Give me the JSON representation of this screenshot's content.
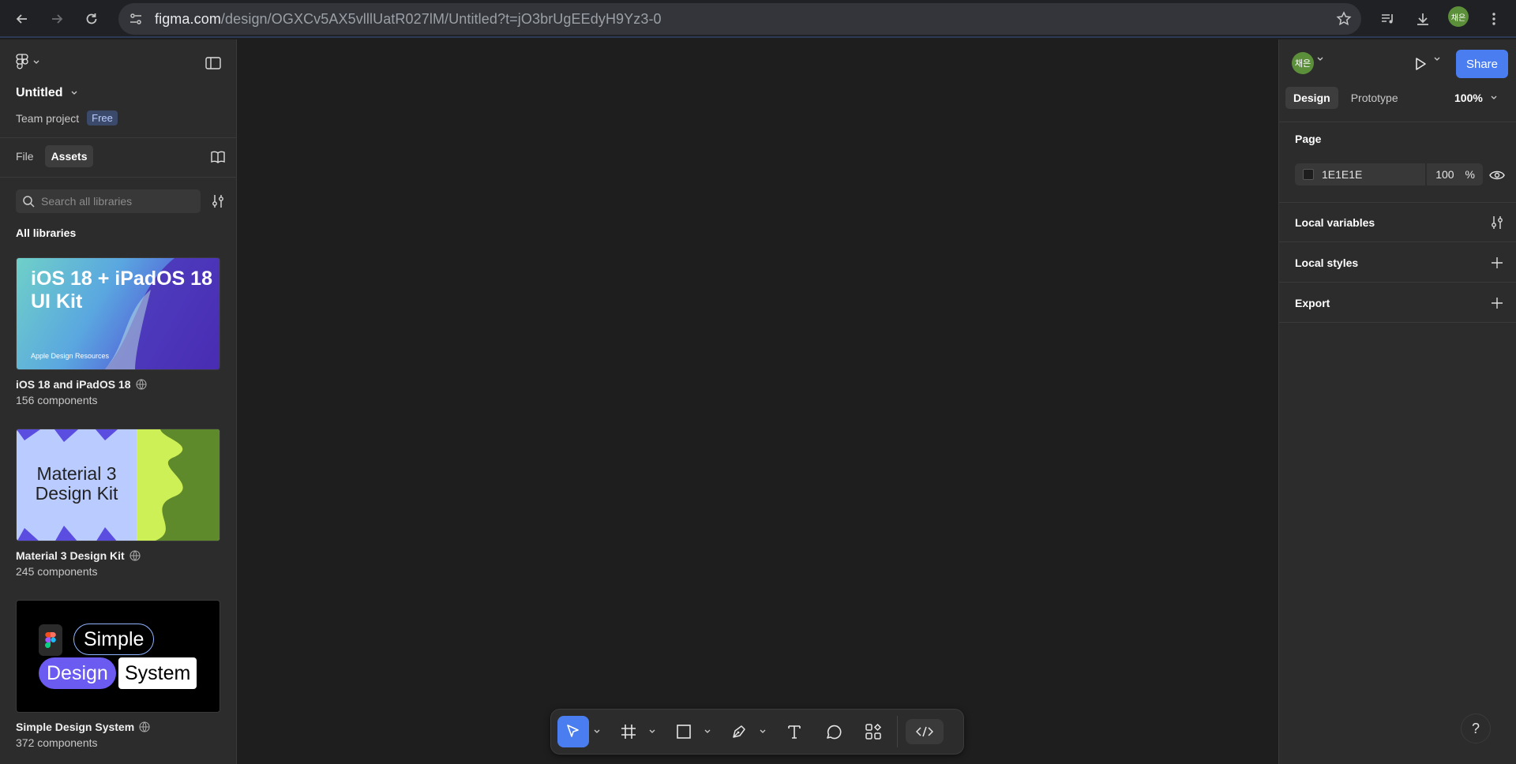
{
  "browser": {
    "url_host": "figma.com",
    "url_path": "/design/OGXCv5AX5vlllUatR027lM/Untitled?t=jO3brUgEEdyH9Yz3-0",
    "profile_initials": "채은"
  },
  "left_panel": {
    "file_title": "Untitled",
    "team": "Team project",
    "plan_badge": "Free",
    "tabs": [
      {
        "label": "File"
      },
      {
        "label": "Assets"
      }
    ],
    "search_placeholder": "Search all libraries",
    "libraries_heading": "All libraries",
    "libraries": [
      {
        "name": "iOS 18 and iPadOS 18",
        "count": "156 components",
        "thumb_title": "iOS 18 + iPadOS 18 UI Kit",
        "thumb_caption": "Apple Design Resources"
      },
      {
        "name": "Material 3 Design Kit",
        "count": "245 components",
        "thumb_title": "Material 3 Design Kit"
      },
      {
        "name": "Simple Design System",
        "count": "372 components",
        "thumb_words": [
          "Simple",
          "Design",
          "System"
        ]
      }
    ]
  },
  "right_panel": {
    "avatar_initials": "채은",
    "share_label": "Share",
    "tabs": [
      {
        "label": "Design"
      },
      {
        "label": "Prototype"
      }
    ],
    "zoom": "100%",
    "page_section": "Page",
    "page_color": "1E1E1E",
    "page_opacity": "100",
    "opacity_unit": "%",
    "local_variables": "Local variables",
    "local_styles": "Local styles",
    "export": "Export"
  },
  "toolbar": {
    "tools": [
      "move-tool",
      "frame-tool",
      "shape-tool",
      "pen-tool",
      "text-tool",
      "comment-tool",
      "actions-tool",
      "dev-mode-toggle"
    ]
  },
  "help_label": "?",
  "colors": {
    "accent": "#4a7ef0",
    "canvas": "#1e1e1e",
    "panel": "#2c2c2c"
  }
}
